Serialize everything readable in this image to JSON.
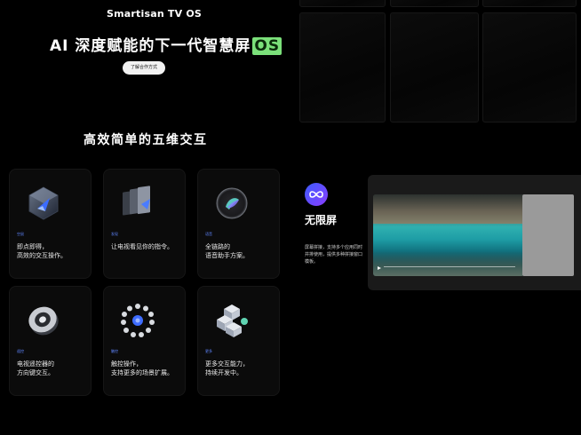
{
  "header": {
    "brand": "Smartisan TV OS",
    "title_main": "AI 深度赋能的下一代智慧屏",
    "title_highlight": "OS",
    "cta_label": "了解合作方式"
  },
  "section": {
    "title": "高效简单的五维交互"
  },
  "cards": [
    {
      "tag": "空鼠",
      "desc": "即点即得，\n高效的交互操作。",
      "icon": "cube-cursor-icon"
    },
    {
      "tag": "发现",
      "desc": "让电视看见你的指令。",
      "icon": "layered-panels-icon"
    },
    {
      "tag": "语音",
      "desc": "全链路的\n语音助手方案。",
      "icon": "voice-orb-icon"
    },
    {
      "tag": "遥控",
      "desc": "电视遥控器的\n方向键交互。",
      "icon": "dpad-remote-icon"
    },
    {
      "tag": "触控",
      "desc": "触控操作，\n支持更多的场景扩展。",
      "icon": "touch-ring-icon"
    },
    {
      "tag": "更多",
      "desc": "更多交互能力，\n持续开发中。",
      "icon": "stacked-cubes-icon"
    }
  ],
  "feature": {
    "icon": "infinity-icon",
    "name": "无限屏",
    "desc": "屏幕拼接，支持多个应用同时并排使用，提供多种拼接窗口模板。"
  },
  "colors": {
    "accent_green": "#7be07a",
    "tag_blue": "#5f86ff",
    "background": "#000000"
  }
}
